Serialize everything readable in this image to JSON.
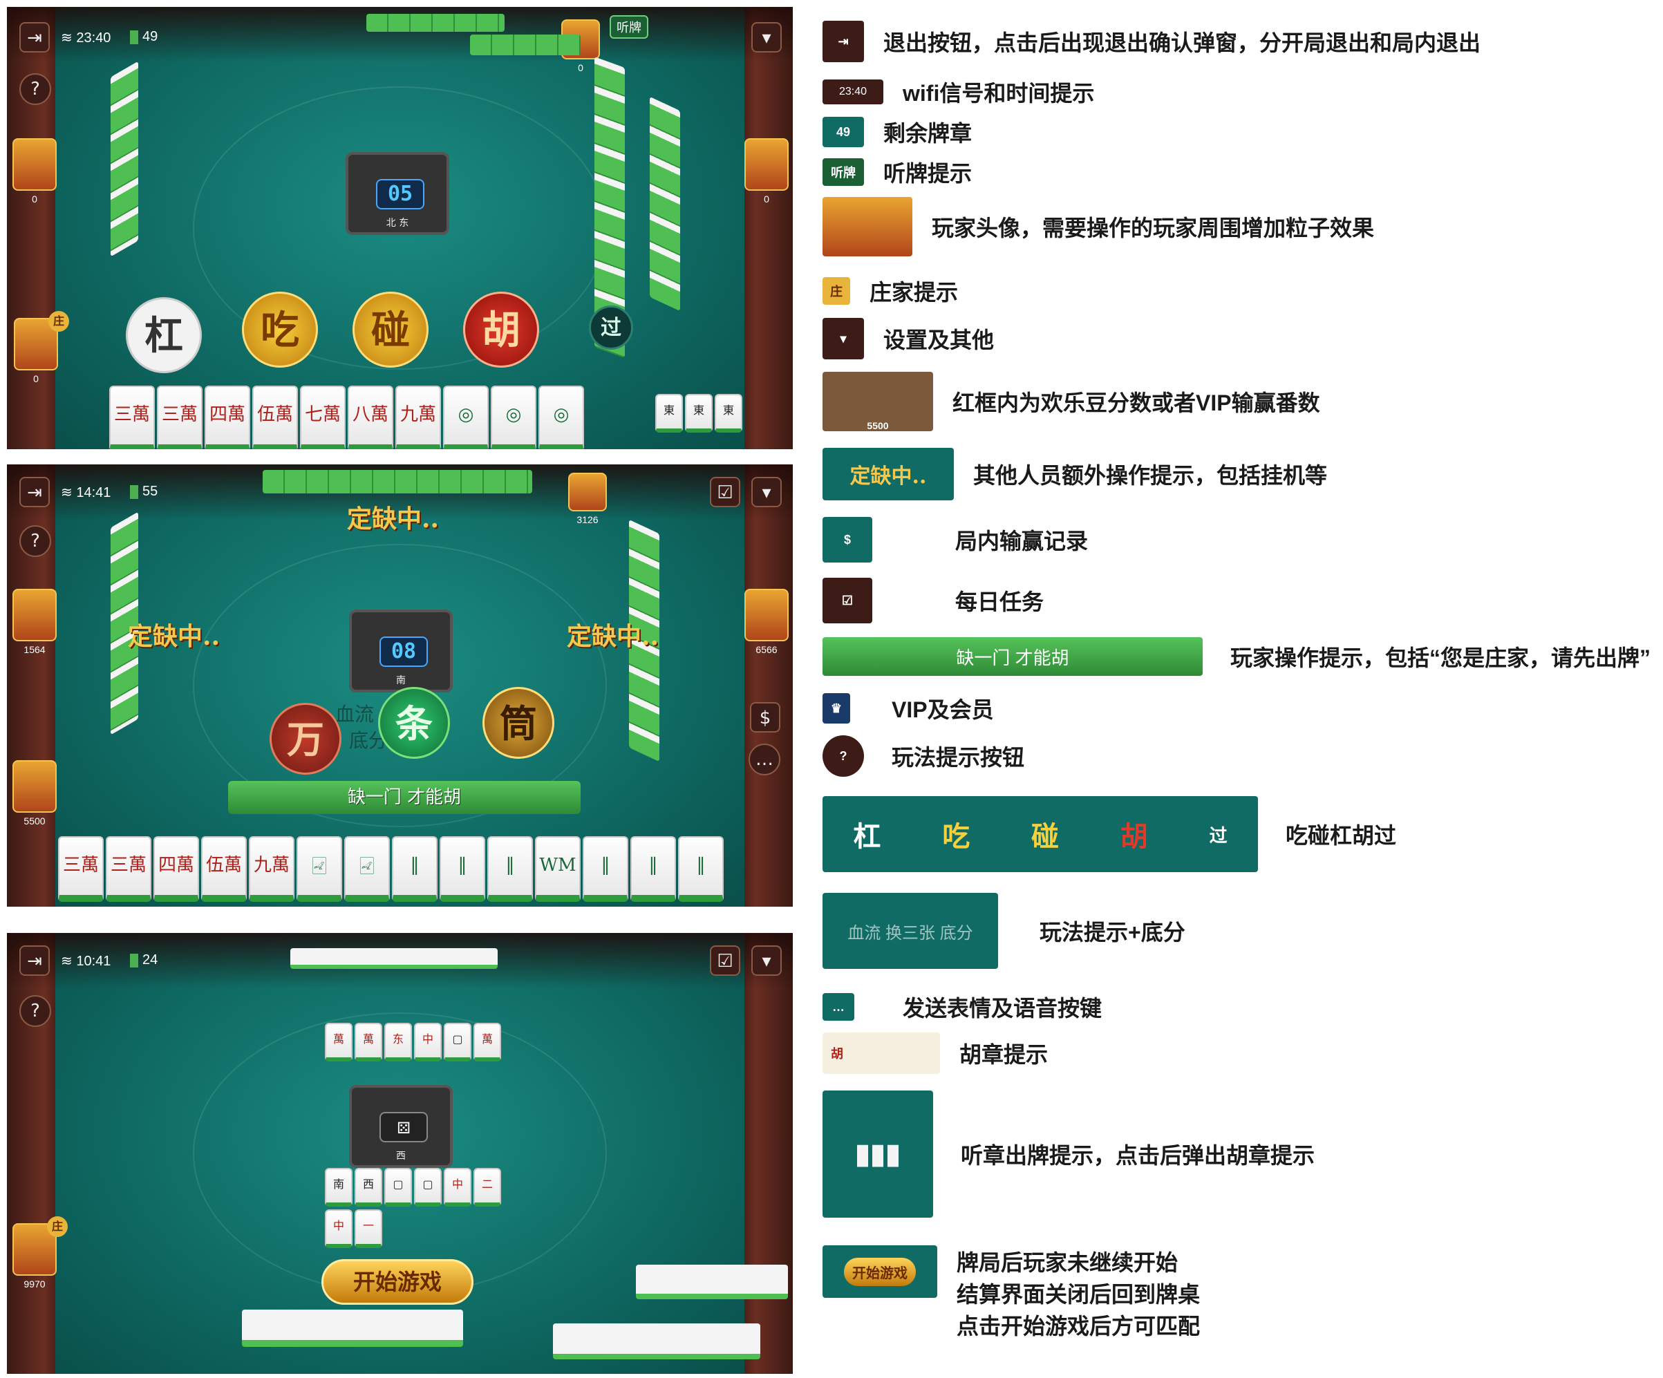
{
  "screen1": {
    "time": "23:40",
    "remaining": "49",
    "listen_label": "听牌",
    "avatar_scores": [
      "0",
      "0",
      "0",
      "0"
    ],
    "banker_mark": "庄",
    "center_number": "05",
    "center_dirs": "北 东",
    "actions": {
      "gang": "杠",
      "chi": "吃",
      "peng": "碰",
      "hu": "胡",
      "guo": "过"
    },
    "hand_tiles": [
      "三萬",
      "三萬",
      "四萬",
      "伍萬",
      "七萬",
      "八萬",
      "九萬",
      "◎",
      "◎",
      "◎"
    ],
    "side_tiles": [
      "東",
      "東",
      "東"
    ]
  },
  "screen2": {
    "time": "14:41",
    "remaining": "55",
    "scores": [
      "1564",
      "3126",
      "6566",
      "5500"
    ],
    "status_texts": [
      "定缺中..",
      "定缺中..",
      "定缺中.."
    ],
    "center_number": "08",
    "center_dir": "南",
    "rule_note": "血流 换三张",
    "rule_note2": "底分",
    "suits": {
      "wan": "万",
      "tiao": "条",
      "tong": "筒"
    },
    "hint": "缺一门 才能胡",
    "hand_tiles": [
      "三萬",
      "三萬",
      "四萬",
      "伍萬",
      "九萬",
      "🀐",
      "🀐",
      "‖",
      "‖",
      "‖",
      "WM",
      "‖",
      "‖",
      "‖"
    ]
  },
  "screen3": {
    "time": "10:41",
    "remaining": "24",
    "score": "9970",
    "banker_mark": "庄",
    "center_dir": "西",
    "start_button": "开始游戏",
    "discards_top": [
      "萬",
      "萬",
      "东",
      "中",
      "▢",
      "萬"
    ],
    "discards_bottom": [
      "南",
      "西",
      "▢",
      "▢",
      "中",
      "二",
      "中",
      "一"
    ]
  },
  "legend": [
    {
      "thumb": "exit-icon",
      "text": "退出按钮，点击后出现退出确认弹窗，分开局退出和局内退出"
    },
    {
      "thumb": "23:40",
      "text": "wifi信号和时间提示"
    },
    {
      "thumb": "49",
      "text": "剩余牌章"
    },
    {
      "thumb": "听牌",
      "text": "听牌提示"
    },
    {
      "thumb": "avatar",
      "text": "玩家头像，需要操作的玩家周围增加粒子效果"
    },
    {
      "thumb": "庄",
      "text": "庄家提示"
    },
    {
      "thumb": "chevron-down-icon",
      "text": "设置及其他"
    },
    {
      "thumb": "5500",
      "text": "红框内为欢乐豆分数或者VIP输赢番数"
    },
    {
      "thumb": "定缺中..",
      "text": "其他人员额外操作提示，包括挂机等"
    },
    {
      "thumb": "record-icon",
      "text": "局内输赢记录"
    },
    {
      "thumb": "calendar-icon",
      "text": "每日任务"
    },
    {
      "thumb": "缺一门 才能胡",
      "text": "玩家操作提示，包括“您是庄家，请先出牌”"
    },
    {
      "thumb": "vip",
      "text": "VIP及会员"
    },
    {
      "thumb": "help-icon",
      "text": "玩法提示按钮"
    },
    {
      "thumb": "actions",
      "text": "吃碰杠胡过"
    },
    {
      "thumb": "血流 换三张 底分",
      "text": "玩法提示+底分"
    },
    {
      "thumb": "chat-icon",
      "text": "发送表情及语音按键"
    },
    {
      "thumb": "胡",
      "text": "胡章提示"
    },
    {
      "thumb": "tiles",
      "text": "听章出牌提示，点击后弹出胡章提示"
    },
    {
      "thumb": "开始游戏",
      "text": "牌局后玩家未继续开始"
    },
    {
      "thumb": "",
      "text": "结算界面关闭后回到牌桌"
    },
    {
      "thumb": "",
      "text": "点击开始游戏后方可匹配"
    }
  ]
}
